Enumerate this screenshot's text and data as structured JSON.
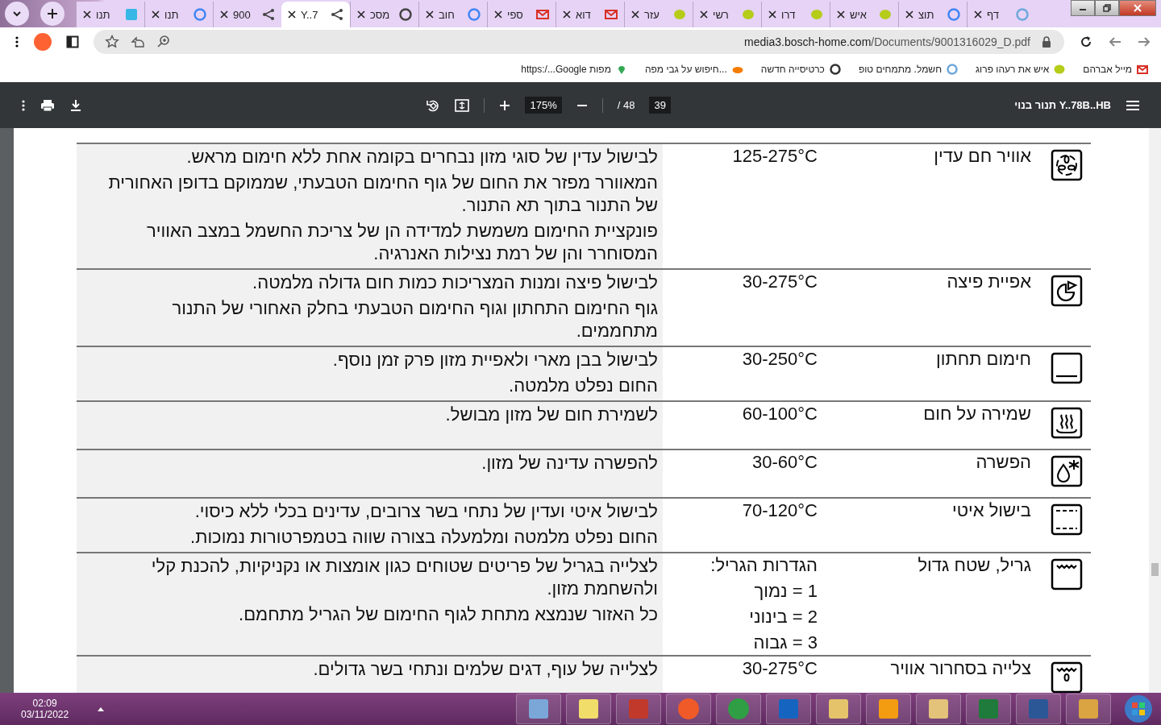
{
  "tabs": [
    {
      "label": "דף",
      "selected": false
    },
    {
      "label": "תוצ",
      "selected": false
    },
    {
      "label": "איש",
      "selected": false
    },
    {
      "label": "דרו",
      "selected": false
    },
    {
      "label": "רשי",
      "selected": false
    },
    {
      "label": "עזר",
      "selected": false
    },
    {
      "label": "דוא",
      "selected": false
    },
    {
      "label": "ספי",
      "selected": false
    },
    {
      "label": "חוב",
      "selected": false
    },
    {
      "label": "מסכ",
      "selected": false
    },
    {
      "label": "Y..7",
      "selected": true
    },
    {
      "label": "900",
      "selected": false
    },
    {
      "label": "תנו",
      "selected": false
    },
    {
      "label": "תנו",
      "selected": false
    }
  ],
  "address": {
    "host": "media3.bosch-home.com",
    "path": "/Documents/9001316029_D.pdf"
  },
  "bookmarks": [
    {
      "label": "מייל אברהם"
    },
    {
      "label": "איש את רעהו פרוג"
    },
    {
      "label": "חשמל. מתמחים טופ"
    },
    {
      "label": "כרטיסייה חדשה"
    },
    {
      "label": "חיפוש על גבי מפה..."
    },
    {
      "label": "https:/...Google מפות"
    }
  ],
  "pdf_toolbar": {
    "title": "תנור בנוי Y..78B..HB",
    "page": "39",
    "total": "/ 48",
    "zoom": "175%"
  },
  "table": {
    "rows": [
      {
        "kind": "fan",
        "name": "אוויר חם עדין",
        "temp": [
          "125-275°C"
        ],
        "text": [
          "לבישול עדין של סוגי מזון נבחרים בקומה אחת ללא חימום מראש.",
          "המאוורר מפזר את החום של גוף החימום הטבעתי, שממוקם בדופן האחורית של התנור בתוך תא התנור.",
          "פונקציית החימום משמשת למדידה הן של צריכת החשמל במצב האוויר המסוחרר והן של רמת נצילות האנרגיה."
        ]
      },
      {
        "kind": "pizza",
        "name": "אפיית פיצה",
        "temp": [
          "30-275°C"
        ],
        "text": [
          "לבישול פיצה ומנות המצריכות כמות חום גדולה מלמטה.",
          "גוף החימום התחתון וגוף החימום הטבעתי בחלק האחורי של התנור מתחממים."
        ]
      },
      {
        "kind": "bottom",
        "name": "חימום תחתון",
        "temp": [
          "30-250°C"
        ],
        "text": [
          "לבישול בבן מארי ולאפיית מזון פרק זמן נוסף.",
          "החום נפלט מלמטה."
        ]
      },
      {
        "kind": "warm",
        "name": "שמירה על חום",
        "temp": [
          "60-100°C"
        ],
        "text": [
          "לשמירת חום של מזון מבושל."
        ]
      },
      {
        "kind": "defrost",
        "name": "הפשרה",
        "temp": [
          "30-60°C"
        ],
        "text": [
          "להפשרה עדינה של מזון."
        ]
      },
      {
        "kind": "slow",
        "name": "בישול איטי",
        "temp": [
          "70-120°C"
        ],
        "text": [
          "לבישול איטי ועדין של נתחי בשר צרובים, עדינים בכלי ללא כיסוי.",
          "החום נפלט מלמטה ומלמעלה בצורה שווה בטמפרטורות נמוכות."
        ]
      },
      {
        "kind": "grill",
        "name": "גריל, שטח גדול",
        "temp": [
          "הגדרות הגריל:",
          "1 = נמוך",
          "2 = בינוני",
          "3 = גבוה"
        ],
        "text": [
          "לצלייה בגריל של פריטים שטוחים כגון אומצות או נקניקיות, להכנת קלי ולהשחמת מזון.",
          "כל האזור שנמצא מתחת לגוף החימום של הגריל מתחמם."
        ]
      },
      {
        "kind": "grillfan",
        "name": "צלייה בסחרור אוויר",
        "temp": [
          "30-275°C"
        ],
        "text": [
          "לצלייה של עוף, דגים שלמים ונתחי בשר גדולים."
        ]
      }
    ]
  },
  "taskbar": {
    "time": "02:09",
    "date": "03/11/2022"
  }
}
